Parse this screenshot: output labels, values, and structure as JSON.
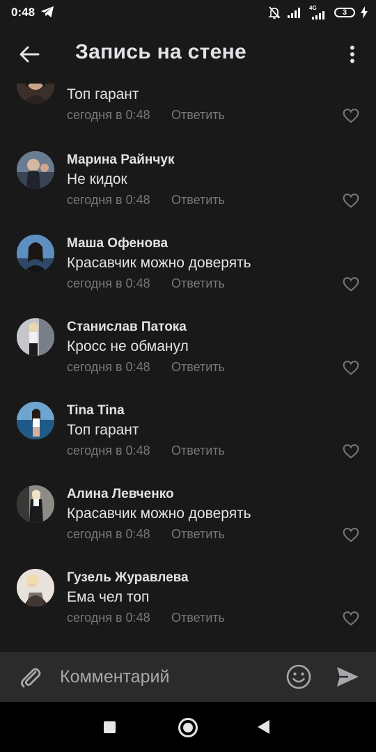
{
  "status_bar": {
    "time": "0:48",
    "network": "4G",
    "battery": "3"
  },
  "header": {
    "title": "Запись на стене",
    "back_icon": "arrow-left-icon",
    "more_icon": "vertical-dots-icon"
  },
  "comments": [
    {
      "name": "",
      "text": "Топ гарант",
      "time": "сегодня в 0:48",
      "reply": "Ответить",
      "avatar_color": "#4a3b35"
    },
    {
      "name": "Марина Райнчук",
      "text": "Не кидок",
      "time": "сегодня в 0:48",
      "reply": "Ответить",
      "avatar_color": "#5b6f86"
    },
    {
      "name": "Маша Офенова",
      "text": "Красавчик можно доверять",
      "time": "сегодня в 0:48",
      "reply": "Ответить",
      "avatar_color": "#3e6e98"
    },
    {
      "name": "Станислав Патока",
      "text": "Кросс не обманул",
      "time": "сегодня в 0:48",
      "reply": "Ответить",
      "avatar_color": "#8d8a92"
    },
    {
      "name": "Tina Tina",
      "text": "Топ гарант",
      "time": "сегодня в 0:48",
      "reply": "Ответить",
      "avatar_color": "#2f6a9a"
    },
    {
      "name": "Алина Левченко",
      "text": "Красавчик можно доверять",
      "time": "сегодня в 0:48",
      "reply": "Ответить",
      "avatar_color": "#6b6866"
    },
    {
      "name": "Гузель Журавлева",
      "text": "Ема чел топ",
      "time": "сегодня в 0:48",
      "reply": "Ответить",
      "avatar_color": "#b8a898"
    }
  ],
  "input_bar": {
    "placeholder": "Комментарий",
    "attach_icon": "paperclip-icon",
    "emoji_icon": "smiley-icon",
    "send_icon": "send-icon"
  },
  "colors": {
    "background": "#191919",
    "text_primary": "#e1e3e6",
    "text_secondary": "#76787a",
    "input_bar": "#2b2b2b"
  }
}
